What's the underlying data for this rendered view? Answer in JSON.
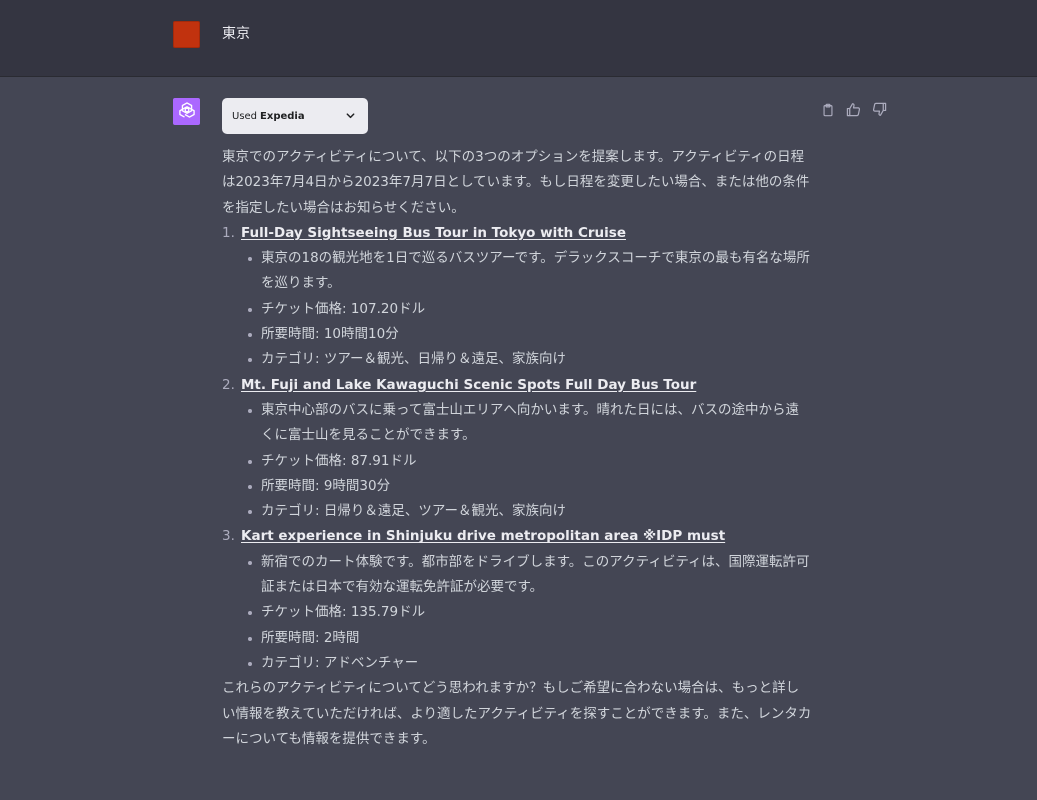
{
  "user": {
    "message": "東京"
  },
  "assistant": {
    "plugin": {
      "used_label": "Used",
      "name": "Expedia"
    },
    "intro": "東京でのアクティビティについて、以下の3つのオプションを提案します。アクティビティの日程は2023年7月4日から2023年7月7日としています。もし日程を変更したい場合、または他の条件を指定したい場合はお知らせください。",
    "options": [
      {
        "number": "1.",
        "title": "Full-Day Sightseeing Bus Tour in Tokyo with Cruise",
        "details": [
          "東京の18の観光地を1日で巡るバスツアーです。デラックスコーチで東京の最も有名な場所を巡ります。",
          "チケット価格: 107.20ドル",
          "所要時間: 10時間10分",
          "カテゴリ: ツアー＆観光、日帰り＆遠足、家族向け"
        ]
      },
      {
        "number": "2.",
        "title": "Mt. Fuji and Lake Kawaguchi Scenic Spots Full Day Bus Tour",
        "details": [
          "東京中心部のバスに乗って富士山エリアへ向かいます。晴れた日には、バスの途中から遠くに富士山を見ることができます。",
          "チケット価格: 87.91ドル",
          "所要時間: 9時間30分",
          "カテゴリ: 日帰り＆遠足、ツアー＆観光、家族向け"
        ]
      },
      {
        "number": "3.",
        "title": "Kart experience in Shinjuku drive metropolitan area ※IDP must",
        "details": [
          "新宿でのカート体験です。都市部をドライブします。このアクティビティは、国際運転許可証または日本で有効な運転免許証が必要です。",
          "チケット価格: 135.79ドル",
          "所要時間: 2時間",
          "カテゴリ: アドベンチャー"
        ]
      }
    ],
    "closing": "これらのアクティビティについてどう思われますか？もしご希望に合わない場合は、もっと詳しい情報を教えていただければ、より適したアクティビティを探すことができます。また、レンタカーについても情報を提供できます。"
  },
  "icons": {
    "copy": "clipboard-icon",
    "thumbs_up": "thumbs-up-icon",
    "thumbs_down": "thumbs-down-icon",
    "assistant_logo": "openai-logo-icon",
    "dropdown": "chevron-down-icon"
  },
  "colors": {
    "user_avatar": "#c1320e",
    "assistant_avatar": "#ab68ff",
    "background": "#444654",
    "user_row": "#343541"
  }
}
